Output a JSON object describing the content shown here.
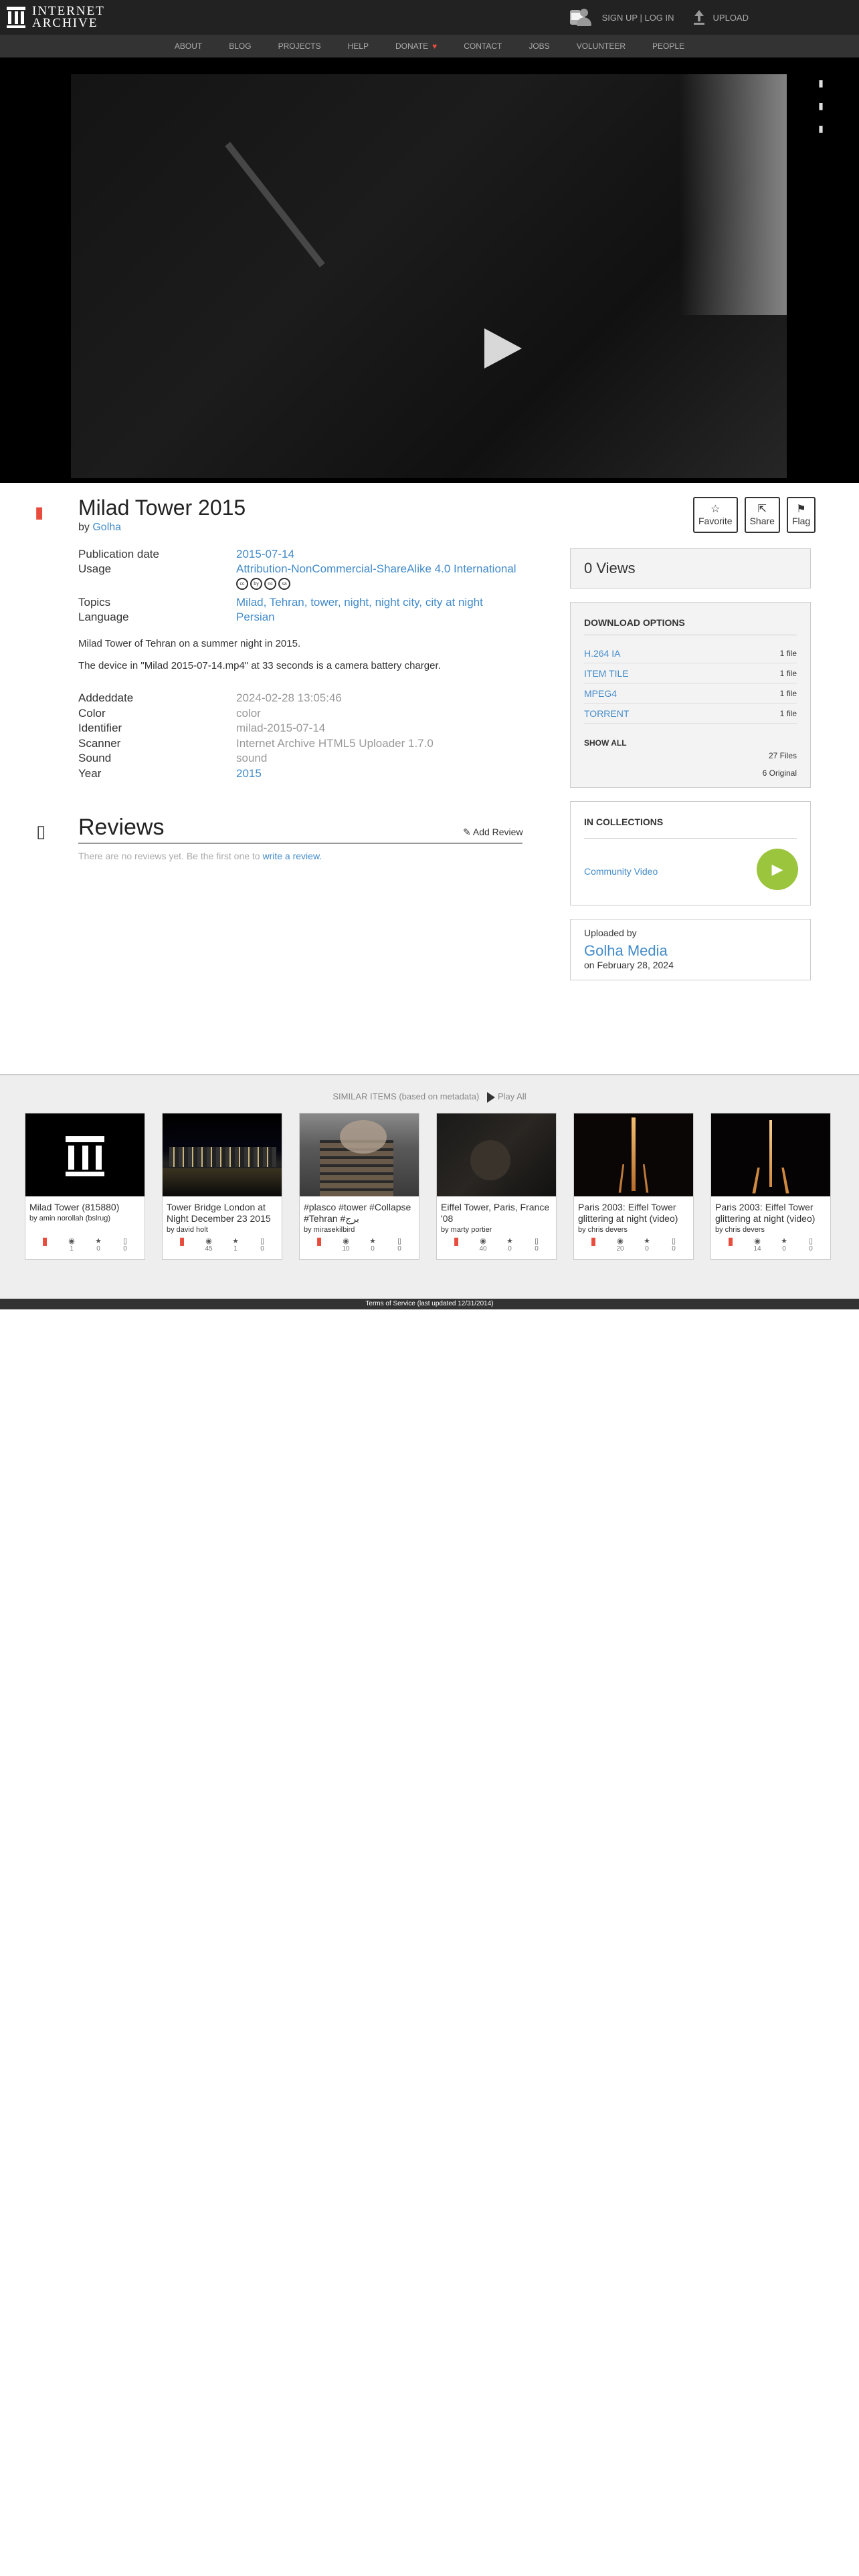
{
  "header": {
    "logo_line1": "INTERNET",
    "logo_line2": "ARCHIVE",
    "signup": "SIGN UP | LOG IN",
    "upload": "UPLOAD"
  },
  "subnav": [
    "ABOUT",
    "BLOG",
    "PROJECTS",
    "HELP",
    "DONATE",
    "CONTACT",
    "JOBS",
    "VOLUNTEER",
    "PEOPLE"
  ],
  "item": {
    "title": "Milad Tower 2015",
    "by_prefix": "by",
    "author": "Golha",
    "favorite": "Favorite",
    "share": "Share",
    "flag": "Flag",
    "metadata_top": [
      {
        "key": "Publication date",
        "value": "2015-07-14"
      },
      {
        "key": "Usage",
        "value": "Attribution-NonCommercial-ShareAlike 4.0 International"
      }
    ],
    "license_icons": [
      "cc",
      "by",
      "nc",
      "sa"
    ],
    "metadata_mid": [
      {
        "key": "Topics",
        "value": "Milad, Tehran, tower, night, night city, city at night"
      },
      {
        "key": "Language",
        "value": "Persian"
      }
    ],
    "description": [
      "Milad Tower of Tehran on a summer night in 2015.",
      "The device in \"Milad 2015-07-14.mp4\" at 33 seconds is a camera battery charger."
    ],
    "metadata_bottom": [
      {
        "key": "Addeddate",
        "value": "2024-02-28 13:05:46"
      },
      {
        "key": "Color",
        "value": "color"
      },
      {
        "key": "Identifier",
        "value": "milad-2015-07-14"
      },
      {
        "key": "Scanner",
        "value": "Internet Archive HTML5 Uploader 1.7.0"
      },
      {
        "key": "Sound",
        "value": "sound"
      },
      {
        "key": "Year",
        "value": "2015"
      }
    ]
  },
  "reviews": {
    "title": "Reviews",
    "add": "Add Review",
    "empty_prefix": "There are no reviews yet. Be the first one to",
    "empty_link": "write a review."
  },
  "sidebar": {
    "views": "0 Views",
    "download_title": "DOWNLOAD OPTIONS",
    "downloads": [
      {
        "label": "H.264 IA",
        "count": "1 file"
      },
      {
        "label": "ITEM TILE",
        "count": "1 file"
      },
      {
        "label": "MPEG4",
        "count": "1 file"
      },
      {
        "label": "TORRENT",
        "count": "1 file"
      }
    ],
    "show_all": "SHOW ALL",
    "files_total": "27 Files",
    "files_original": "6 Original",
    "collections_title": "IN COLLECTIONS",
    "collection": "Community Video",
    "uploaded_by_label": "Uploaded by",
    "uploader": "Golha Media",
    "uploaded_on": "on February 28, 2024"
  },
  "similar": {
    "title": "SIMILAR ITEMS (based on metadata)",
    "play_all": "Play All",
    "items": [
      {
        "title": "Milad Tower (815880)",
        "by": "by amin norollah (bslrug)",
        "views": "1",
        "favs": "0",
        "reviews": "0"
      },
      {
        "title": "Tower Bridge London at Night December 23 2015",
        "by": "by david holt",
        "views": "45",
        "favs": "1",
        "reviews": "0"
      },
      {
        "title": "#plasco #tower #Collapse #Tehran #برج",
        "by": "by mirasekilbird",
        "views": "10",
        "favs": "0",
        "reviews": "0"
      },
      {
        "title": "Eiffel Tower, Paris, France '08",
        "by": "by marty portier",
        "views": "40",
        "favs": "0",
        "reviews": "0"
      },
      {
        "title": "Paris 2003: Eiffel Tower glittering at night (video)",
        "by": "by chris devers",
        "views": "20",
        "favs": "0",
        "reviews": "0"
      },
      {
        "title": "Paris 2003: Eiffel Tower glittering at night (video)",
        "by": "by chris devers",
        "views": "14",
        "favs": "0",
        "reviews": "0"
      }
    ]
  },
  "footer": "Terms of Service (last updated 12/31/2014)"
}
